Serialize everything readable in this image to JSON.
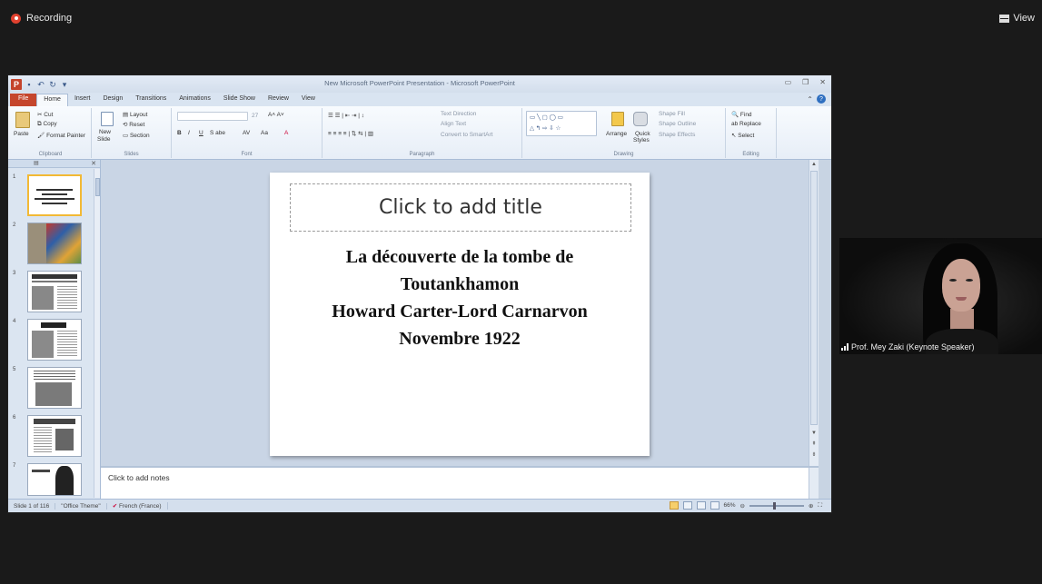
{
  "zoom": {
    "recording_label": "Recording",
    "view_label": "View",
    "participant_name": "Prof. Mey Zaki (Keynote Speaker)"
  },
  "ppt": {
    "window_title": "New Microsoft PowerPoint Presentation - Microsoft PowerPoint",
    "tabs": [
      "File",
      "Home",
      "Insert",
      "Design",
      "Transitions",
      "Animations",
      "Slide Show",
      "Review",
      "View"
    ],
    "active_tab": "Home",
    "ribbon": {
      "clipboard": {
        "paste": "Paste",
        "cut": "Cut",
        "copy": "Copy",
        "format_painter": "Format Painter",
        "label": "Clipboard"
      },
      "slides": {
        "new_slide": "New",
        "new_slide_2": "Slide",
        "layout": "Layout",
        "reset": "Reset",
        "section": "Section",
        "label": "Slides"
      },
      "font": {
        "label": "Font",
        "size": "27"
      },
      "paragraph": {
        "text_direction": "Text Direction",
        "align_text": "Align Text",
        "convert_smartart": "Convert to SmartArt",
        "label": "Paragraph"
      },
      "drawing": {
        "arrange": "Arrange",
        "quick_styles": "Quick",
        "quick_styles_2": "Styles",
        "shape_fill": "Shape Fill",
        "shape_outline": "Shape Outline",
        "shape_effects": "Shape Effects",
        "label": "Drawing"
      },
      "editing": {
        "find": "Find",
        "replace": "Replace",
        "select": "Select",
        "label": "Editing"
      }
    },
    "thumbnails": [
      "1",
      "2",
      "3",
      "4",
      "5",
      "6",
      "7"
    ],
    "slide": {
      "title_placeholder": "Click to add title",
      "body_lines": [
        "La découverte de la tombe de",
        "Toutankhamon",
        "Howard Carter-Lord Carnarvon",
        "Novembre 1922"
      ]
    },
    "notes_placeholder": "Click to add notes",
    "status": {
      "slide_count": "Slide 1 of 116",
      "theme": "\"Office Theme\"",
      "language": "French (France)",
      "zoom": "66%"
    }
  }
}
